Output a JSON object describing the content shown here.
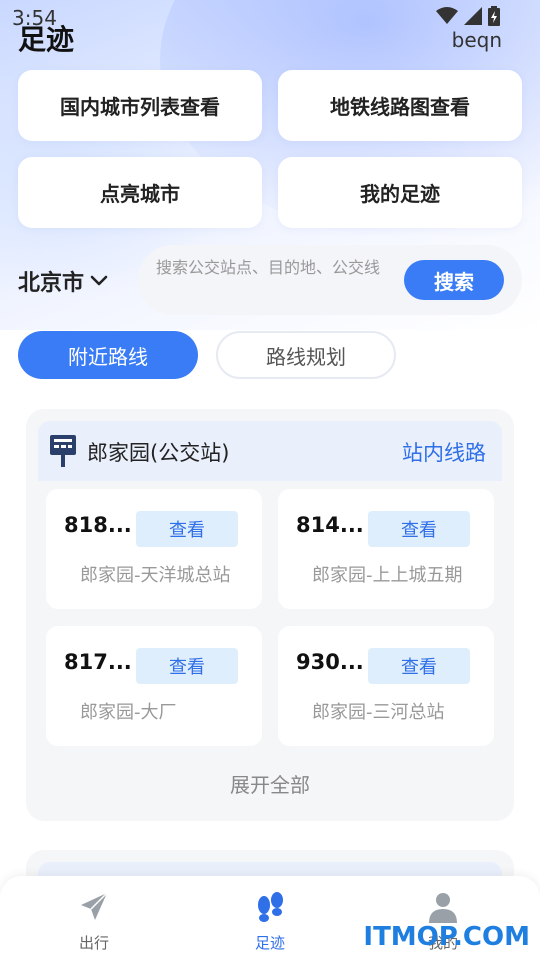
{
  "status_bar": {
    "time": "3:54",
    "carrier": "beqn"
  },
  "page_title": "足迹",
  "quick_actions": [
    {
      "label": "国内城市列表查看"
    },
    {
      "label": "地铁线路图查看"
    },
    {
      "label": "点亮城市"
    },
    {
      "label": "我的足迹"
    }
  ],
  "search": {
    "city": "北京市",
    "placeholder": "搜索公交站点、目的地、公交线",
    "button_label": "搜索"
  },
  "tabs": [
    {
      "label": "附近路线",
      "active": true
    },
    {
      "label": "路线规划",
      "active": false
    }
  ],
  "station": {
    "name": "郎家园(公交站)",
    "link_label": "站内线路",
    "routes": [
      {
        "number": "818...",
        "view_label": "查看",
        "destination": "郎家园-天洋城总站"
      },
      {
        "number": "814...",
        "view_label": "查看",
        "destination": "郎家园-上上城五期"
      },
      {
        "number": "817...",
        "view_label": "查看",
        "destination": "郎家园-大厂"
      },
      {
        "number": "930...",
        "view_label": "查看",
        "destination": "郎家园-三河总站"
      }
    ],
    "expand_label": "展开全部"
  },
  "bottom_nav": [
    {
      "label": "出行",
      "icon": "paper-plane-icon"
    },
    {
      "label": "足迹",
      "icon": "footprints-icon",
      "active": true
    },
    {
      "label": "我的",
      "icon": "user-icon"
    }
  ],
  "watermark": "ITMOP.COM",
  "colors": {
    "accent": "#3a7cf5",
    "link": "#2f6fe8",
    "chip_bg": "#dfeefc"
  }
}
